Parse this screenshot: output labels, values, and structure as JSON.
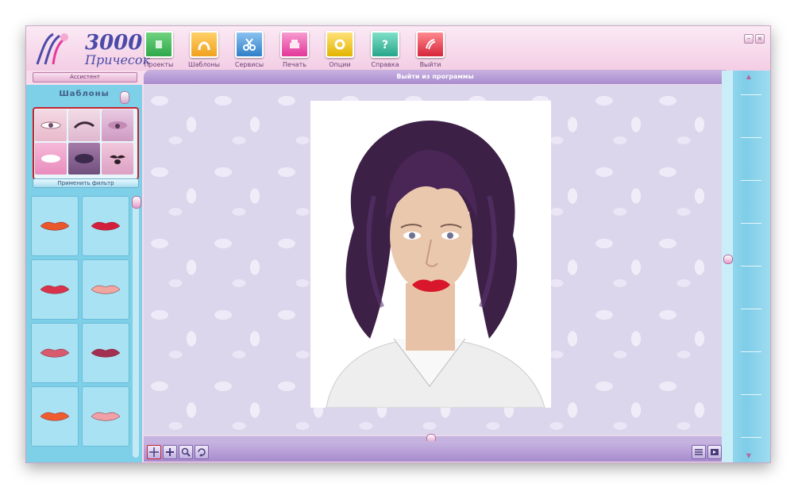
{
  "app": {
    "logo": {
      "number": "3000",
      "word": "Причесок"
    }
  },
  "toolbar": {
    "buttons": [
      {
        "id": "projects",
        "label": "Проекты",
        "icon": "projects-icon",
        "color": "#2fa84a"
      },
      {
        "id": "templates",
        "label": "Шаблоны",
        "icon": "templates-icon",
        "color": "#f0a21e"
      },
      {
        "id": "services",
        "label": "Сервисы",
        "icon": "scissors-icon",
        "color": "#2f7fc8"
      },
      {
        "id": "print",
        "label": "Печать",
        "icon": "print-icon",
        "color": "#e3369a"
      },
      {
        "id": "options",
        "label": "Опции",
        "icon": "options-icon",
        "color": "#e2b400"
      },
      {
        "id": "help",
        "label": "Справка",
        "icon": "help-icon",
        "color": "#27a58b"
      },
      {
        "id": "exit",
        "label": "Выйти",
        "icon": "exit-icon",
        "color": "#d6253a"
      }
    ]
  },
  "assistant": {
    "label": "Ассистент"
  },
  "canvas": {
    "title": "Выйти из программы"
  },
  "left_panel": {
    "header": "Шаблоны",
    "filters": [
      {
        "name": "eyes-filter-1"
      },
      {
        "name": "brows-filter"
      },
      {
        "name": "eyes-filter-2"
      },
      {
        "name": "lips-filter"
      },
      {
        "name": "eyeshadow-filter"
      },
      {
        "name": "mustache-filter"
      }
    ],
    "apply_filter_label": "Применить фильтр",
    "lips": [
      {
        "color": "#e9572a"
      },
      {
        "color": "#d21f3c"
      },
      {
        "color": "#d8334a"
      },
      {
        "color": "#f0a7a0"
      },
      {
        "color": "#d85a6e"
      },
      {
        "color": "#a23052"
      },
      {
        "color": "#ef5d2e"
      },
      {
        "color": "#f0a0a6"
      }
    ]
  },
  "colors": {
    "hair": "#3d2046",
    "lipstick": "#d8182a",
    "accent_red": "#c8222d"
  }
}
